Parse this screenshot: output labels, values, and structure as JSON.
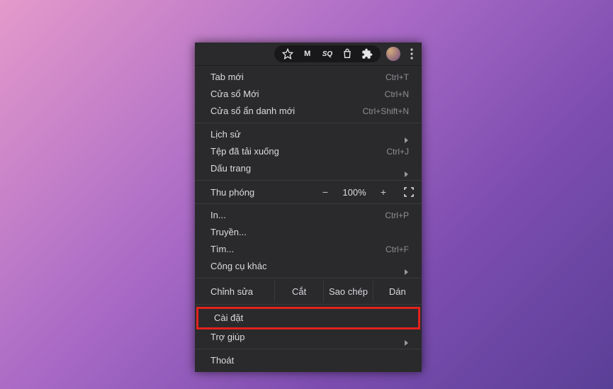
{
  "toolbar": {
    "icons": {
      "star": "star-icon",
      "m_badge": "M",
      "sq_badge": "SQ",
      "bag": "bag-icon",
      "ext": "ext-icon",
      "avatar": "avatar",
      "more": "more-icon"
    }
  },
  "menu": {
    "group1": {
      "new_tab": {
        "label": "Tab mới",
        "shortcut": "Ctrl+T"
      },
      "new_win": {
        "label": "Cửa sổ Mới",
        "shortcut": "Ctrl+N"
      },
      "new_incog": {
        "label": "Cửa sổ ẩn danh mới",
        "shortcut": "Ctrl+Shift+N"
      }
    },
    "group2": {
      "history": {
        "label": "Lịch sử"
      },
      "downloads": {
        "label": "Tệp đã tải xuống",
        "shortcut": "Ctrl+J"
      },
      "bookmarks": {
        "label": "Dấu trang"
      }
    },
    "zoom": {
      "label": "Thu phóng",
      "minus": "−",
      "value": "100%",
      "plus": "+"
    },
    "group3": {
      "print": {
        "label": "In...",
        "shortcut": "Ctrl+P"
      },
      "cast": {
        "label": "Truyền..."
      },
      "find": {
        "label": "Tìm...",
        "shortcut": "Ctrl+F"
      },
      "tools": {
        "label": "Công cụ khác"
      }
    },
    "edit_row": {
      "label": "Chỉnh sửa",
      "cut": "Cắt",
      "copy": "Sao chép",
      "paste": "Dán"
    },
    "group4": {
      "settings": {
        "label": "Cài đặt"
      },
      "help": {
        "label": "Trợ giúp"
      }
    },
    "group5": {
      "exit": {
        "label": "Thoát"
      }
    }
  }
}
